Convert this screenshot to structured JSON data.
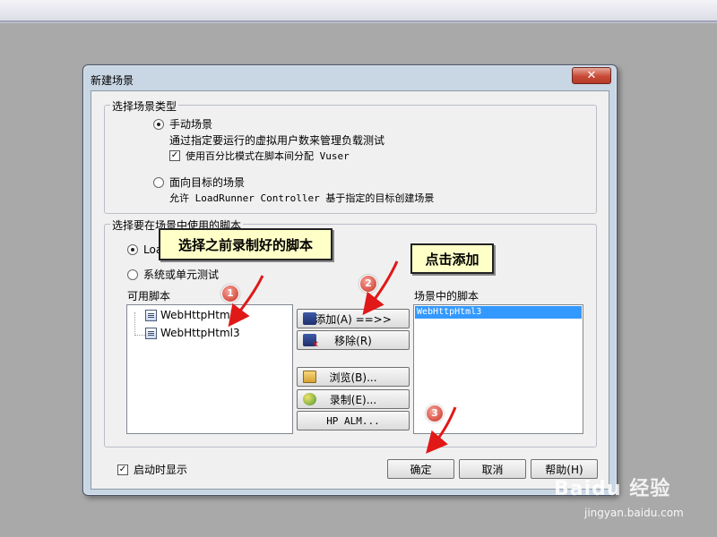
{
  "dialog": {
    "title": "新建场景",
    "close_label": "✕"
  },
  "scenario_type": {
    "legend": "选择场景类型",
    "manual": {
      "label": "手动场景",
      "description": "通过指定要运行的虚拟用户数来管理负载测试",
      "percent_checkbox_label": "使用百分比模式在脚本间分配 Vuser",
      "percent_checked": true,
      "selected": true
    },
    "goal": {
      "label": "面向目标的场景",
      "description": "允许 LoadRunner Controller 基于指定的目标创建场景",
      "selected": false
    }
  },
  "scripts": {
    "legend": "选择要在场景中使用的脚本",
    "loadrunner_option_partial": "Loa",
    "system_option_label": "系统或单元测试",
    "available_label": "可用脚本",
    "available_items": [
      "WebHttpHtml",
      "WebHttpHtml3"
    ],
    "scenario_label": "场景中的脚本",
    "scenario_items": [
      "WebHttpHtml3"
    ]
  },
  "buttons": {
    "add": "添加(A) ==>>",
    "remove": "移除(R)",
    "browse": "浏览(B)...",
    "record": "录制(E)...",
    "alm": "HP ALM...",
    "ok": "确定",
    "cancel": "取消",
    "help": "帮助(H)"
  },
  "footer": {
    "show_on_startup_label": "启动时显示",
    "show_on_startup_checked": true
  },
  "annotations": {
    "callout1": "选择之前录制好的脚本",
    "callout2": "点击添加",
    "badge1": "1",
    "badge2": "2",
    "badge3": "3"
  },
  "watermark": {
    "brand": "Baidu 经验",
    "url": "jingyan.baidu.com"
  }
}
